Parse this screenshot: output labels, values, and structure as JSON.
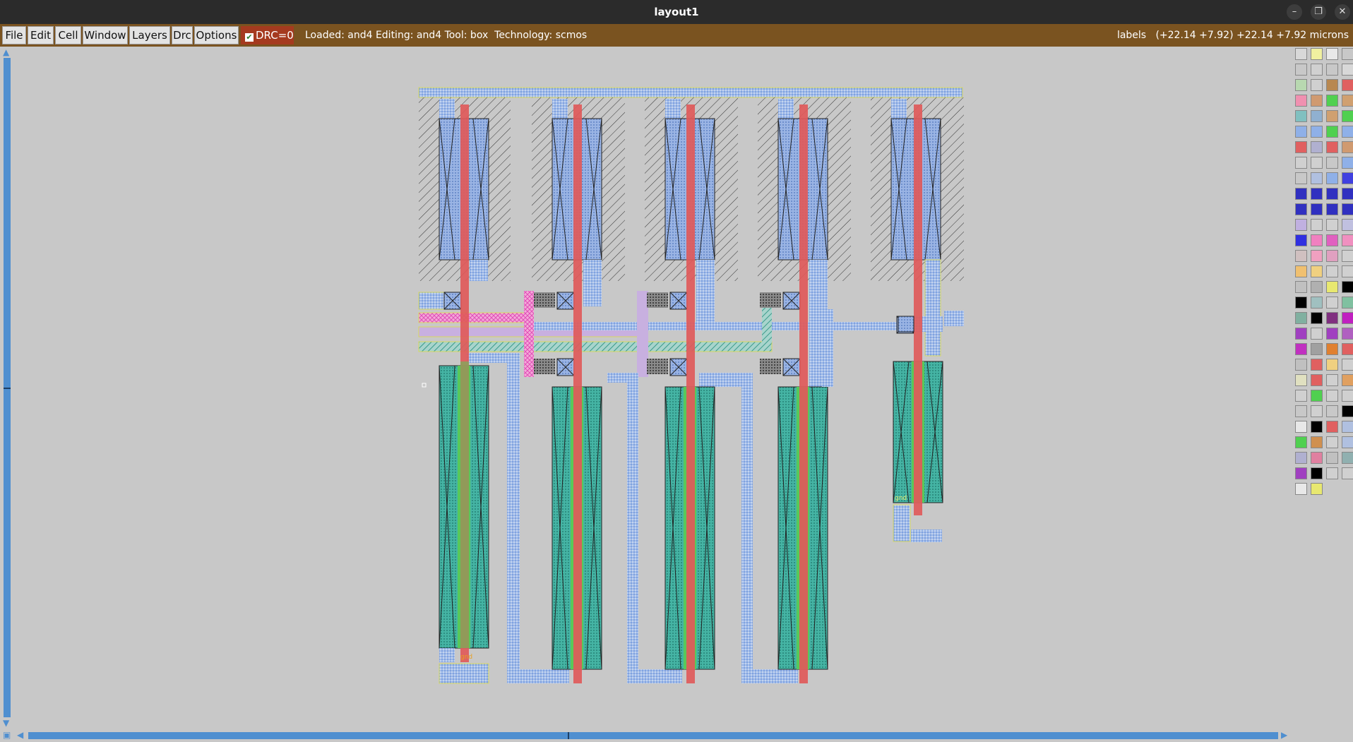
{
  "window": {
    "title": "layout1",
    "controls": {
      "minimize": "–",
      "restore": "❐",
      "close": "✕"
    }
  },
  "menu": {
    "items": [
      "File",
      "Edit",
      "Cell",
      "Window",
      "Layers",
      "Drc",
      "Options"
    ],
    "drc_label": "DRC=0",
    "drc_checked": true
  },
  "status": {
    "text": "Loaded: and4 Editing: and4 Tool: box  Technology: scmos",
    "coords": "labels   (+22.14 +7.92) +22.14 +7.92 microns"
  },
  "layout": {
    "cell_name": "and4",
    "labels": [
      "gnd",
      "gnd"
    ]
  },
  "colors": {
    "poly": "#e05a5a",
    "metal1": "#8fb0e8",
    "ndiff": "#3fb0a0",
    "pdiff": "#8fa8d8",
    "ndiff_inner": "#59c859",
    "nwell": "#333333",
    "label_box": "#e8e870",
    "contact": "#222222",
    "purple": "#b8a0d8",
    "pink": "#e870c8",
    "titlebar": "#2b2b2b",
    "menubar": "#7a5320",
    "drc": "#a53a1f",
    "scroll": "#4f8fd0"
  }
}
